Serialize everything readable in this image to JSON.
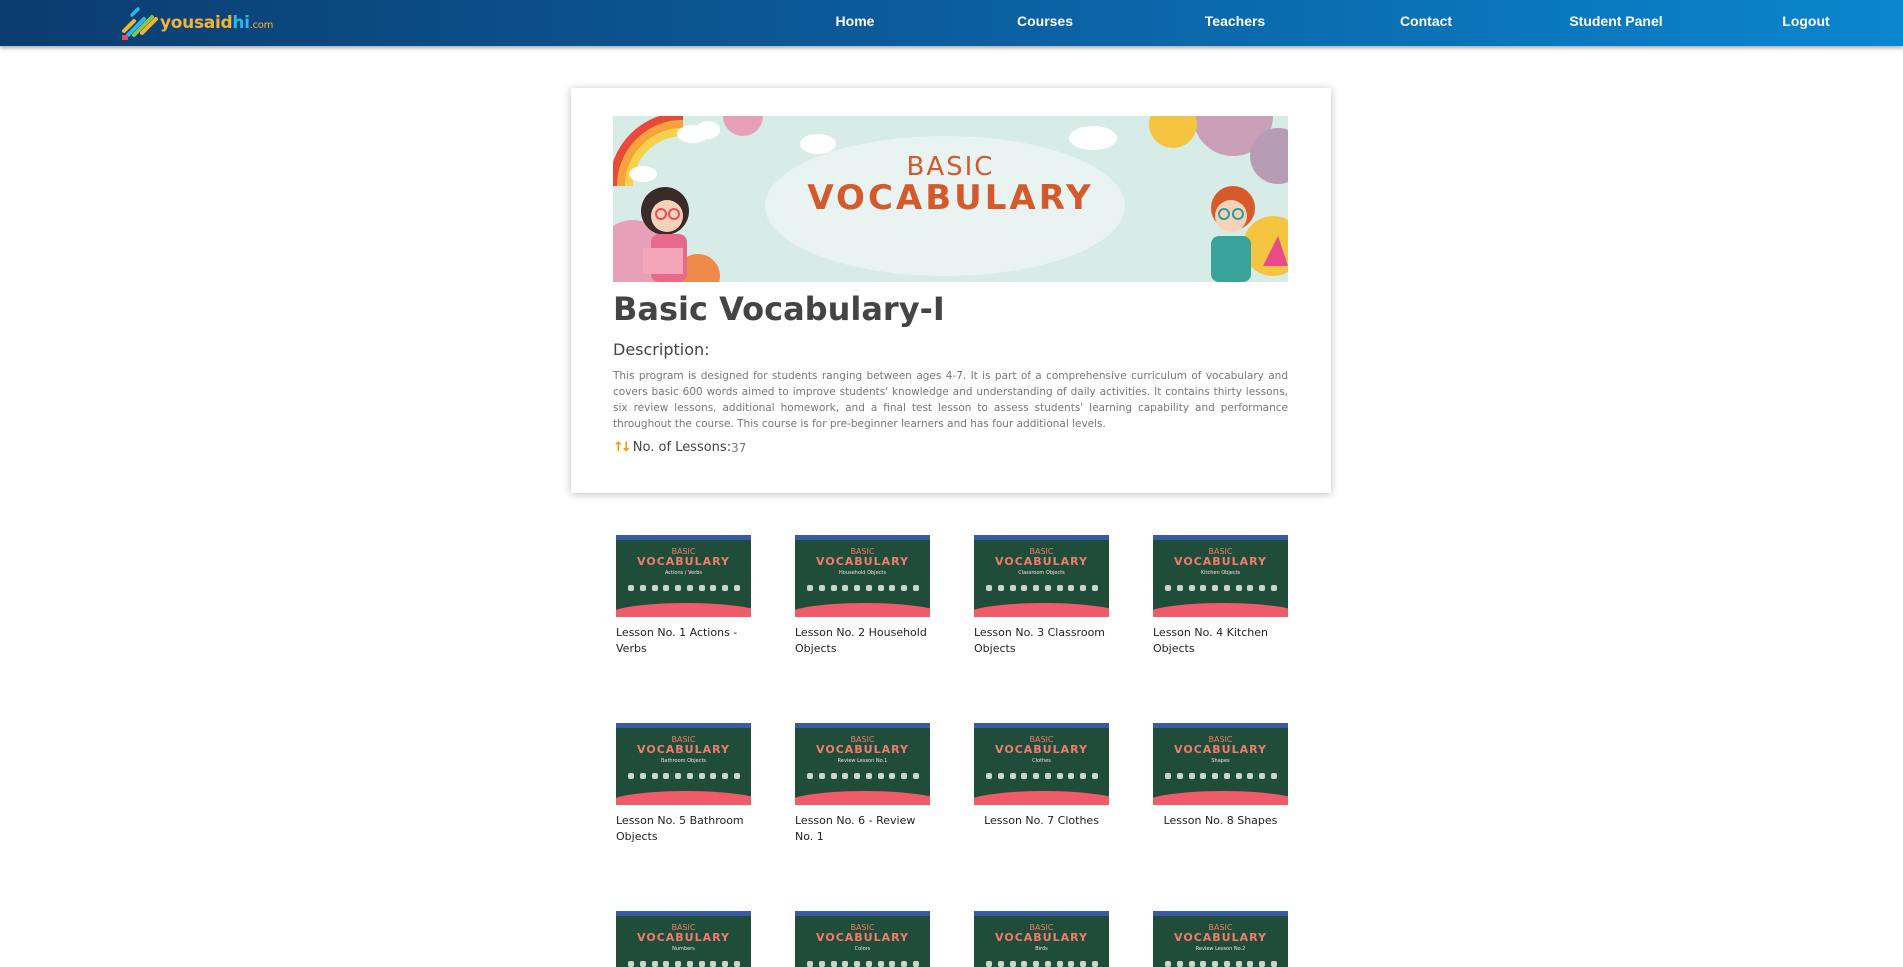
{
  "nav": {
    "logo": {
      "you": "you",
      "said": "said",
      "hi": "hi",
      "com": ".com"
    },
    "items": [
      "Home",
      "Courses",
      "Teachers",
      "Contact",
      "Student Panel",
      "Logout"
    ]
  },
  "course": {
    "banner": {
      "line1": "BASIC",
      "line2": "VOCABULARY"
    },
    "title": "Basic Vocabulary-I",
    "description_label": "Description:",
    "description": "This program is designed for students ranging between ages 4-7. It is part of a comprehensive curriculum of vocabulary and covers basic 600 words aimed to improve students' knowledge and understanding of daily activities. It contains thirty lessons, six review lessons, additional homework, and a final test lesson to assess students' learning capability and performance throughout the course. This course is for pre-beginner learners and has four additional levels.",
    "lessons_label": "No. of Lessons:",
    "lessons_count": "37"
  },
  "lessons": [
    {
      "label": "Lesson No. 1 Actions - Verbs",
      "thumb_line1": "BASIC",
      "thumb_line2": "VOCABULARY",
      "thumb_sub": "Actions / Verbs"
    },
    {
      "label": "Lesson No. 2 Household Objects",
      "thumb_line1": "BASIC",
      "thumb_line2": "VOCABULARY",
      "thumb_sub": "Household Objects"
    },
    {
      "label": "Lesson No. 3 Classroom Objects",
      "thumb_line1": "BASIC",
      "thumb_line2": "VOCABULARY",
      "thumb_sub": "Classroom Objects"
    },
    {
      "label": "Lesson No. 4 Kitchen Objects",
      "thumb_line1": "BASIC",
      "thumb_line2": "VOCABULARY",
      "thumb_sub": "Kitchen Objects"
    },
    {
      "label": "Lesson No. 5 Bathroom Objects",
      "thumb_line1": "BASIC",
      "thumb_line2": "VOCABULARY",
      "thumb_sub": "Bathroom Objects"
    },
    {
      "label": "Lesson No. 6 - Review No. 1",
      "thumb_line1": "BASIC",
      "thumb_line2": "VOCABULARY",
      "thumb_sub": "Review Lesson No.1"
    },
    {
      "label": "Lesson No. 7 Clothes",
      "thumb_line1": "BASIC",
      "thumb_line2": "VOCABULARY",
      "thumb_sub": "Clothes"
    },
    {
      "label": "Lesson No. 8 Shapes",
      "thumb_line1": "BASIC",
      "thumb_line2": "VOCABULARY",
      "thumb_sub": "Shapes"
    },
    {
      "label": "",
      "thumb_line1": "BASIC",
      "thumb_line2": "VOCABULARY",
      "thumb_sub": "Numbers"
    },
    {
      "label": "",
      "thumb_line1": "BASIC",
      "thumb_line2": "VOCABULARY",
      "thumb_sub": "Colors"
    },
    {
      "label": "",
      "thumb_line1": "BASIC",
      "thumb_line2": "VOCABULARY",
      "thumb_sub": "Birds"
    },
    {
      "label": "",
      "thumb_line1": "BASIC",
      "thumb_line2": "VOCABULARY",
      "thumb_sub": "Review Lesson No.2"
    }
  ],
  "colors": {
    "nav_start": "#0b3c6e",
    "nav_end": "#0a86cf",
    "accent_orange": "#f29400",
    "banner_text": "#d45a2c",
    "thumb_green": "#1f4d39",
    "thumb_pink": "#f05b6a"
  }
}
